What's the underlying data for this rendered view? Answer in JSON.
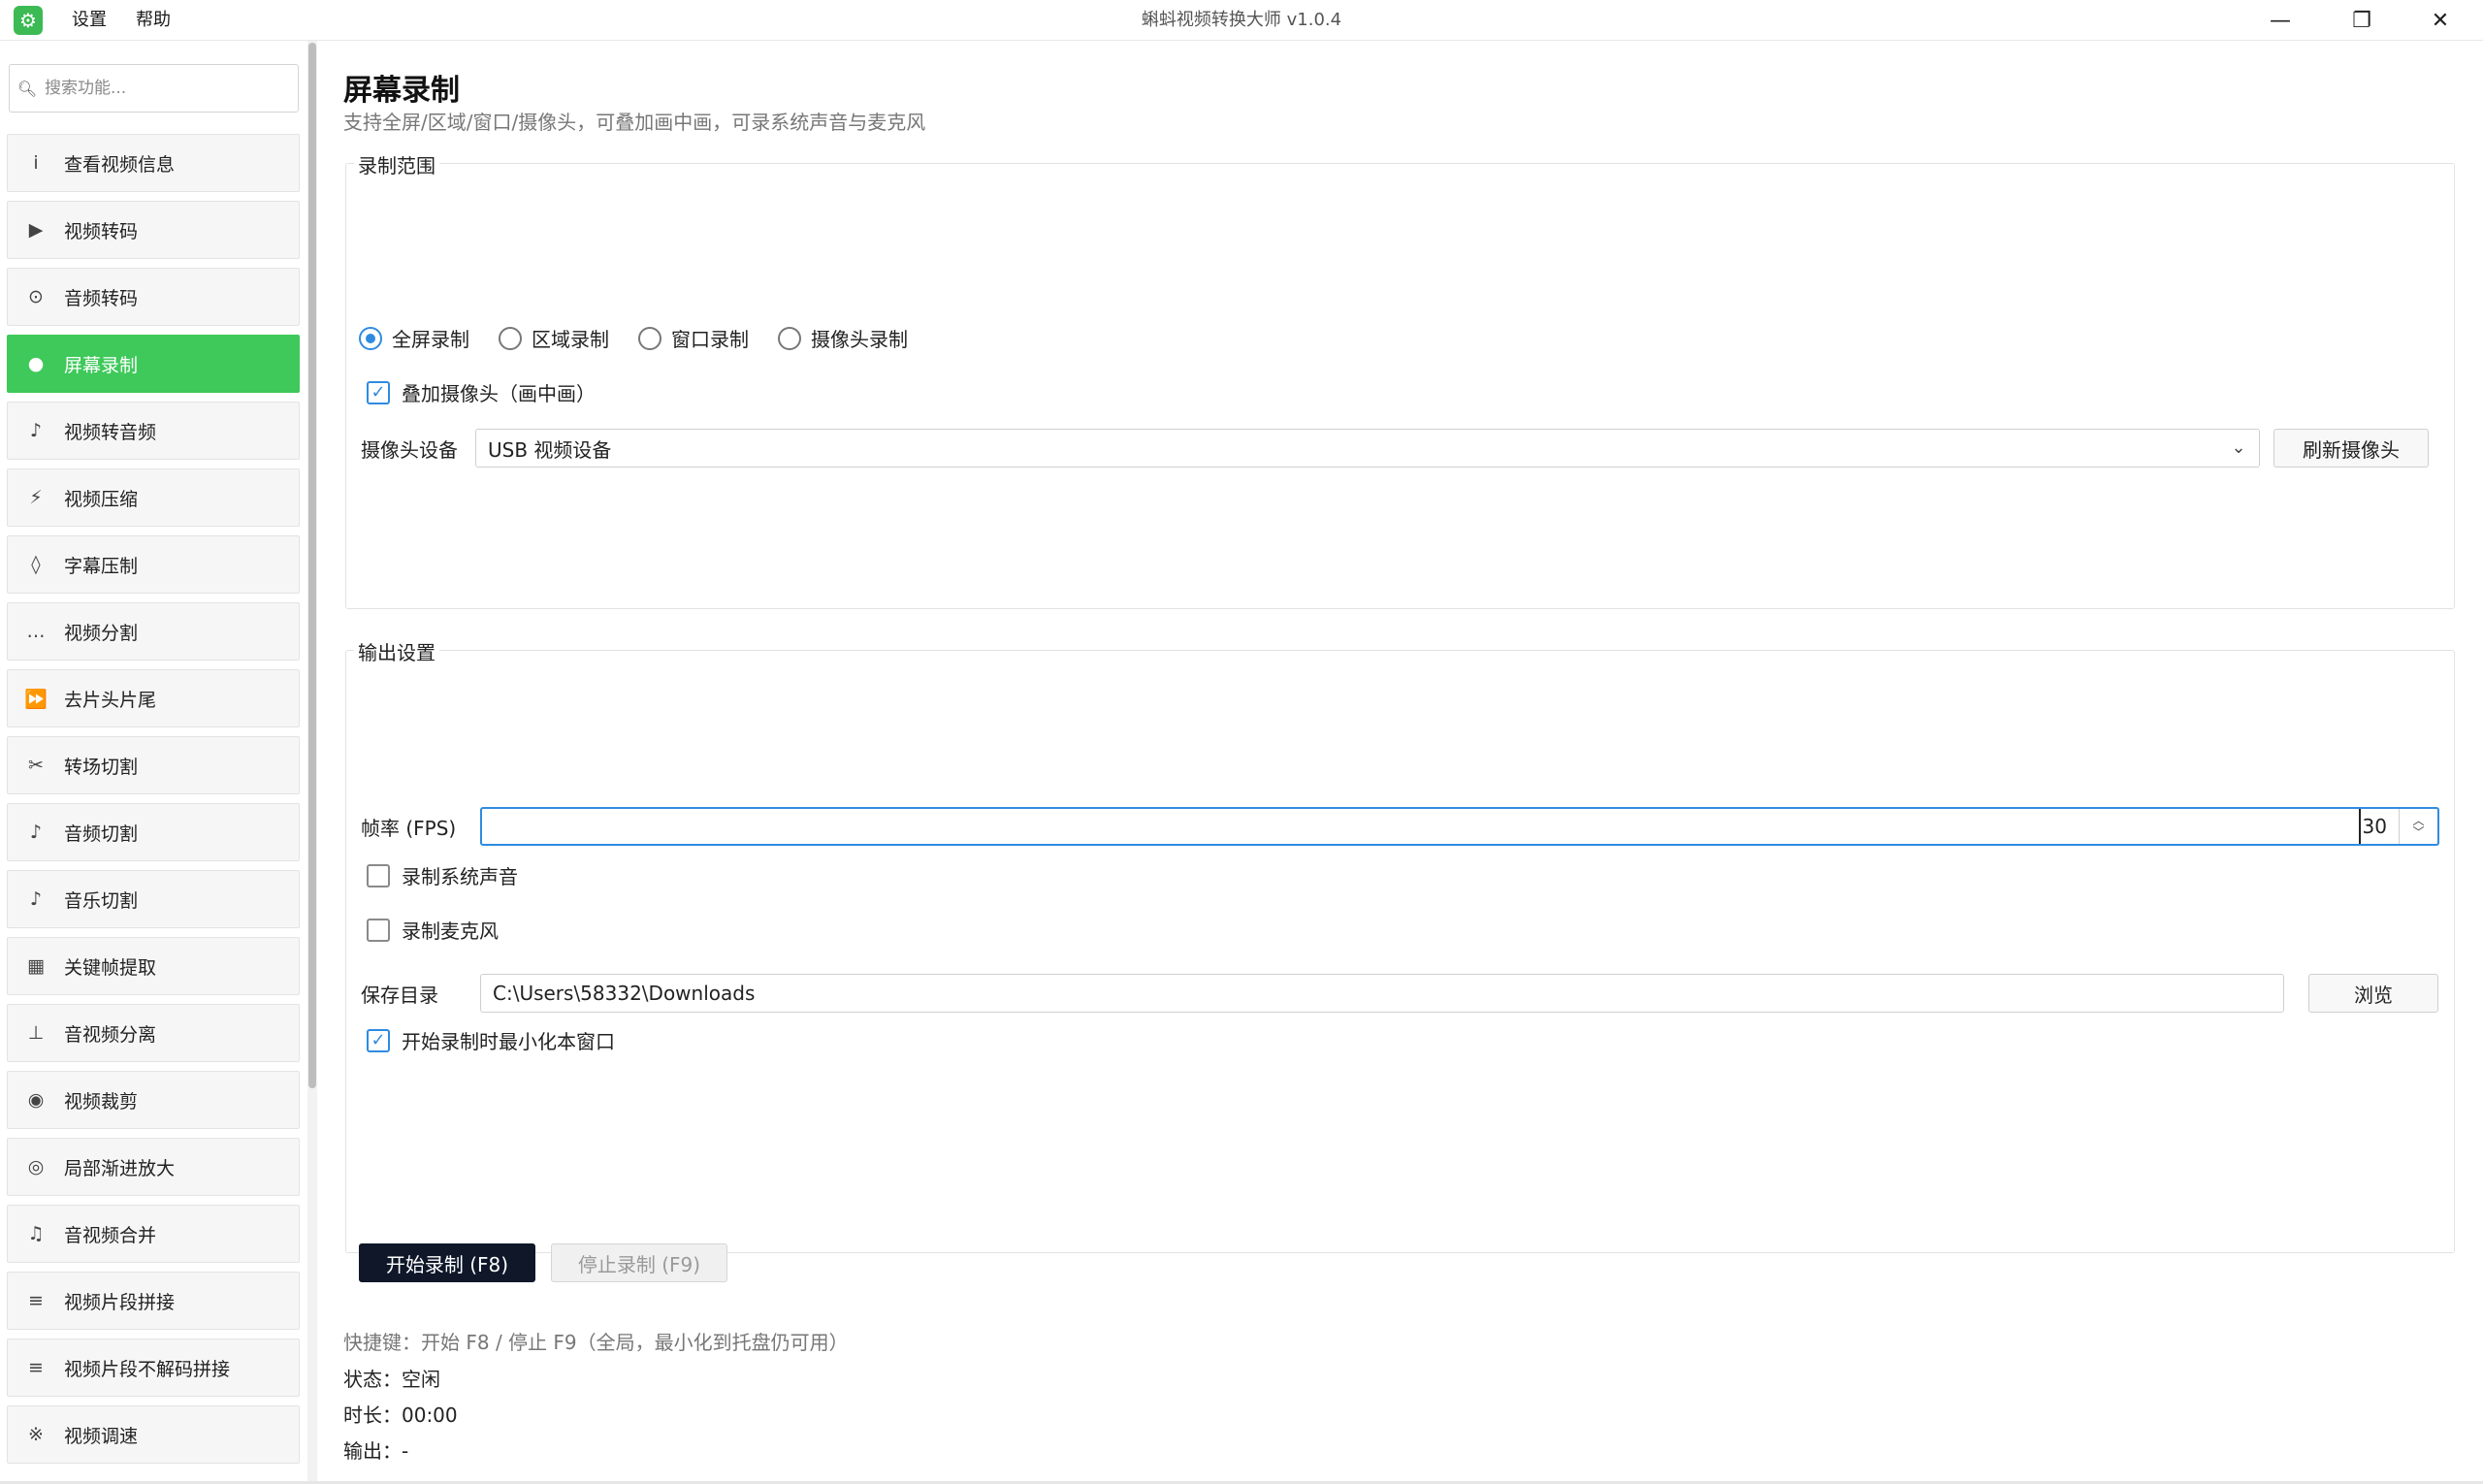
{
  "window": {
    "title": "蝌蚪视频转换大师 v1.0.4",
    "menu": {
      "settings": "设置",
      "help": "帮助"
    },
    "controls": {
      "minimize": "—",
      "maximize": "❐",
      "close": "✕"
    }
  },
  "sidebar": {
    "search_placeholder": "搜索功能...",
    "items": [
      {
        "icon": "i",
        "label": "查看视频信息"
      },
      {
        "icon": "▶",
        "label": "视频转码"
      },
      {
        "icon": "⊙",
        "label": "音频转码"
      },
      {
        "icon": "●",
        "label": "屏幕录制"
      },
      {
        "icon": "♪",
        "label": "视频转音频"
      },
      {
        "icon": "⚡",
        "label": "视频压缩"
      },
      {
        "icon": "◊",
        "label": "字幕压制"
      },
      {
        "icon": "…",
        "label": "视频分割"
      },
      {
        "icon": "⏩",
        "label": "去片头片尾"
      },
      {
        "icon": "✂",
        "label": "转场切割"
      },
      {
        "icon": "♪",
        "label": "音频切割"
      },
      {
        "icon": "♪",
        "label": "音乐切割"
      },
      {
        "icon": "▦",
        "label": "关键帧提取"
      },
      {
        "icon": "⊥",
        "label": "音视频分离"
      },
      {
        "icon": "◉",
        "label": "视频裁剪"
      },
      {
        "icon": "◎",
        "label": "局部渐进放大"
      },
      {
        "icon": "♫",
        "label": "音视频合并"
      },
      {
        "icon": "≡",
        "label": "视频片段拼接"
      },
      {
        "icon": "≡",
        "label": "视频片段不解码拼接"
      },
      {
        "icon": "※",
        "label": "视频调速"
      }
    ]
  },
  "main": {
    "title": "屏幕录制",
    "subtitle": "支持全屏/区域/窗口/摄像头，可叠加画中画，可录系统声音与麦克风",
    "range_group": {
      "title": "录制范围",
      "modes": [
        "全屏录制",
        "区域录制",
        "窗口录制",
        "摄像头录制"
      ],
      "overlay_label": "叠加摄像头（画中画）",
      "camera_label": "摄像头设备",
      "camera_value": "USB 视频设备",
      "refresh_label": "刷新摄像头"
    },
    "output_group": {
      "title": "输出设置",
      "fps_label": "帧率 (FPS)",
      "fps_value": "30",
      "sys_audio_label": "录制系统声音",
      "mic_label": "录制麦克风",
      "save_dir_label": "保存目录",
      "save_dir_value": "C:\\Users\\58332\\Downloads",
      "browse_label": "浏览",
      "minimize_label": "开始录制时最小化本窗口"
    },
    "actions": {
      "start_label": "开始录制 (F8)",
      "stop_label": "停止录制 (F9)"
    },
    "info": {
      "hint": "快捷键：开始 F8 / 停止 F9（全局，最小化到托盘仍可用）",
      "status": "状态：空闲",
      "duration": "时长：00:00",
      "output": "输出：-"
    }
  }
}
